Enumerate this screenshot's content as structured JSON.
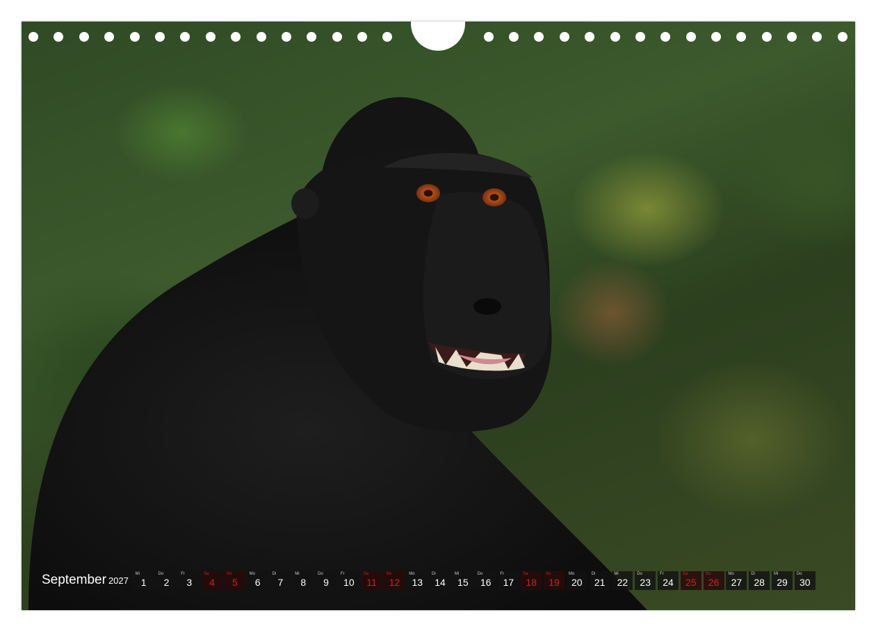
{
  "calendar": {
    "month": "September",
    "year": "2027",
    "days": [
      {
        "wd": "Mi",
        "n": "1",
        "we": false
      },
      {
        "wd": "Do",
        "n": "2",
        "we": false
      },
      {
        "wd": "Fr",
        "n": "3",
        "we": false
      },
      {
        "wd": "Sa",
        "n": "4",
        "we": true
      },
      {
        "wd": "So",
        "n": "5",
        "we": true
      },
      {
        "wd": "Mo",
        "n": "6",
        "we": false
      },
      {
        "wd": "Di",
        "n": "7",
        "we": false
      },
      {
        "wd": "Mi",
        "n": "8",
        "we": false
      },
      {
        "wd": "Do",
        "n": "9",
        "we": false
      },
      {
        "wd": "Fr",
        "n": "10",
        "we": false
      },
      {
        "wd": "Sa",
        "n": "11",
        "we": true
      },
      {
        "wd": "So",
        "n": "12",
        "we": true
      },
      {
        "wd": "Mo",
        "n": "13",
        "we": false
      },
      {
        "wd": "Di",
        "n": "14",
        "we": false
      },
      {
        "wd": "Mi",
        "n": "15",
        "we": false
      },
      {
        "wd": "Do",
        "n": "16",
        "we": false
      },
      {
        "wd": "Fr",
        "n": "17",
        "we": false
      },
      {
        "wd": "Sa",
        "n": "18",
        "we": true
      },
      {
        "wd": "So",
        "n": "19",
        "we": true
      },
      {
        "wd": "Mo",
        "n": "20",
        "we": false
      },
      {
        "wd": "Di",
        "n": "21",
        "we": false
      },
      {
        "wd": "Mi",
        "n": "22",
        "we": false
      },
      {
        "wd": "Do",
        "n": "23",
        "we": false
      },
      {
        "wd": "Fr",
        "n": "24",
        "we": false
      },
      {
        "wd": "Sa",
        "n": "25",
        "we": true
      },
      {
        "wd": "So",
        "n": "26",
        "we": true
      },
      {
        "wd": "Mo",
        "n": "27",
        "we": false
      },
      {
        "wd": "Di",
        "n": "28",
        "we": false
      },
      {
        "wd": "Mi",
        "n": "29",
        "we": false
      },
      {
        "wd": "Do",
        "n": "30",
        "we": false
      }
    ]
  },
  "colors": {
    "weekend": "#c0282a",
    "background": "#3c5a2c"
  }
}
